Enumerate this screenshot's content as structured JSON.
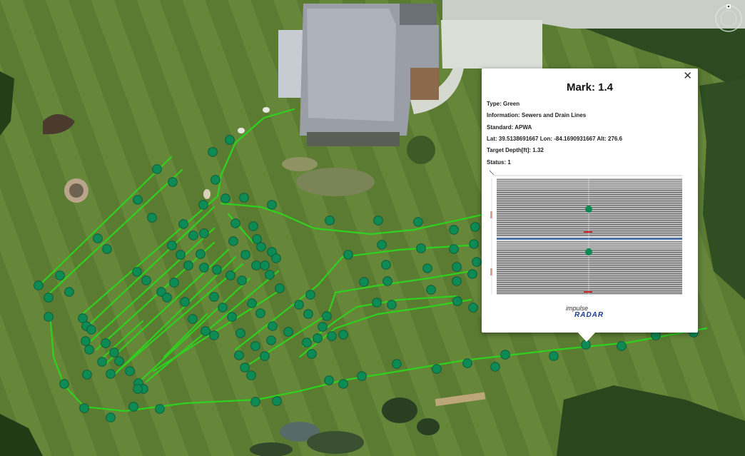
{
  "popup": {
    "title": "Mark: 1.4",
    "close_icon": "close-icon",
    "lines": [
      "Type: Green",
      "Information: Sewers and Drain Lines",
      "Standard: APWA",
      "Lat: 39.5138691667 Lon: -84.1690931667 Alt: 276.6",
      "Target Depth[ft]: 1.32",
      "Status: 1"
    ],
    "logo_top": "impulse",
    "logo_bottom": "RADAR"
  },
  "colors": {
    "track": "#2fd11f",
    "marker_fill": "#0e8a55",
    "marker_stroke": "#0b5c3a",
    "popup_bg": "#ffffff",
    "grass": "#5a7a32"
  },
  "map": {
    "compass_icon": "compass-icon"
  }
}
